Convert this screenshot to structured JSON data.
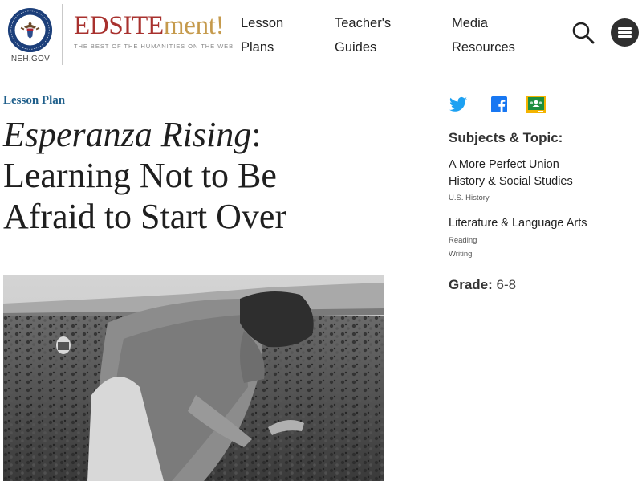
{
  "header": {
    "agency_label": "NEH.GOV",
    "brand_part1": "EDSITE",
    "brand_part2": "ment!",
    "tagline": "THE BEST OF THE HUMANITIES ON THE WEB",
    "nav": [
      {
        "line1": "Lesson",
        "line2": "Plans"
      },
      {
        "line1": "Teacher's",
        "line2": "Guides"
      },
      {
        "line1": "Media",
        "line2": "Resources"
      }
    ],
    "search_icon": "search-icon",
    "menu_icon": "hamburger-menu-icon"
  },
  "main": {
    "kicker": "Lesson Plan",
    "title_italic": "Esperanza Rising",
    "title_rest_1": ":",
    "title_line2": "Learning Not to Be",
    "title_line3": "Afraid to Start Over"
  },
  "sidebar": {
    "share_icons": [
      "twitter-icon",
      "facebook-icon",
      "google-classroom-icon"
    ],
    "subjects_heading": "Subjects & Topic:",
    "subjects": [
      {
        "label": "A More Perfect Union"
      },
      {
        "label": "History & Social Studies",
        "sub": [
          "U.S. History"
        ]
      },
      {
        "label": "Literature & Language Arts",
        "sub": [
          "Reading",
          "Writing"
        ]
      }
    ],
    "grade_label": "Grade:",
    "grade_value": "6-8"
  },
  "colors": {
    "brand_red": "#a8312e",
    "brand_gold": "#c59a4c",
    "kicker_blue": "#1f5f8b",
    "twitter_blue": "#1da1f2",
    "facebook_blue": "#1877f2",
    "classroom_green": "#1e8e3e"
  }
}
